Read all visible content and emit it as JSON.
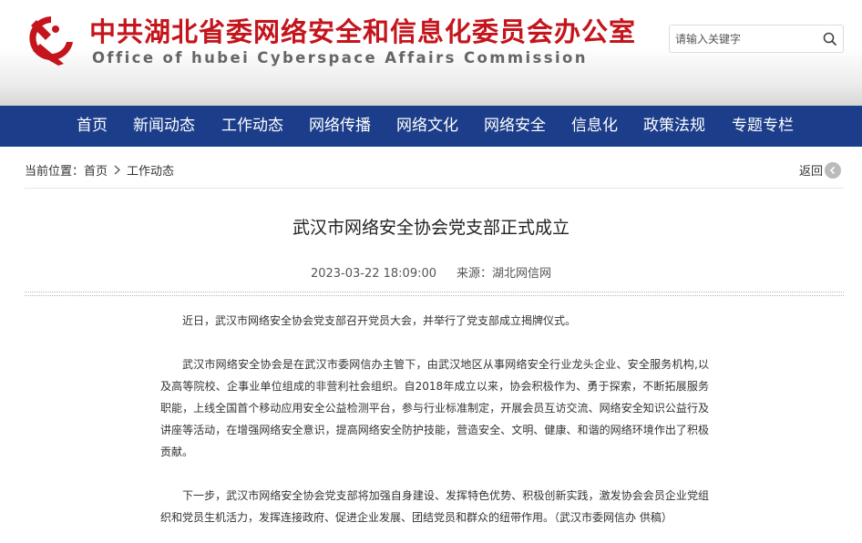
{
  "header": {
    "title": "中共湖北省委网络安全和信息化委员会办公室",
    "subtitle": "Office of hubei Cyberspace Affairs Commission",
    "emblem_icon": "party-emblem-icon",
    "brand_red": "#c4151c"
  },
  "search": {
    "placeholder": "请输入关键字",
    "icon": "search-icon"
  },
  "nav": {
    "background": "#1c3e8a",
    "items": [
      {
        "label": "首页"
      },
      {
        "label": "新闻动态"
      },
      {
        "label": "工作动态"
      },
      {
        "label": "网络传播"
      },
      {
        "label": "网络文化"
      },
      {
        "label": "网络安全"
      },
      {
        "label": "信息化"
      },
      {
        "label": "政策法规"
      },
      {
        "label": "专题专栏"
      }
    ]
  },
  "breadcrumb": {
    "prefix": "当前位置：",
    "home": "首页",
    "current": "工作动态"
  },
  "back": {
    "label": "返回",
    "icon": "back-arrow-icon"
  },
  "article": {
    "title": "武汉市网络安全协会党支部正式成立",
    "date": "2023-03-22 18:09:00",
    "source": "来源：湖北网信网",
    "paragraphs": [
      "近日，武汉市网络安全协会党支部召开党员大会，并举行了党支部成立揭牌仪式。",
      "武汉市网络安全协会是在武汉市委网信办主管下，由武汉地区从事网络安全行业龙头企业、安全服务机构,以及高等院校、企事业单位组成的非营利社会组织。自2018年成立以来，协会积极作为、勇于探索，不断拓展服务职能，上线全国首个移动应用安全公益检测平台，参与行业标准制定，开展会员互访交流、网络安全知识公益行及讲座等活动，在增强网络安全意识，提高网络安全防护技能，营造安全、文明、健康、和谐的网络环境作出了积极贡献。",
      "下一步，武汉市网络安全协会党支部将加强自身建设、发挥特色优势、积极创新实践，激发协会会员企业党组织和党员生机活力，发挥连接政府、促进企业发展、团结党员和群众的纽带作用。（武汉市委网信办 供稿）"
    ]
  }
}
